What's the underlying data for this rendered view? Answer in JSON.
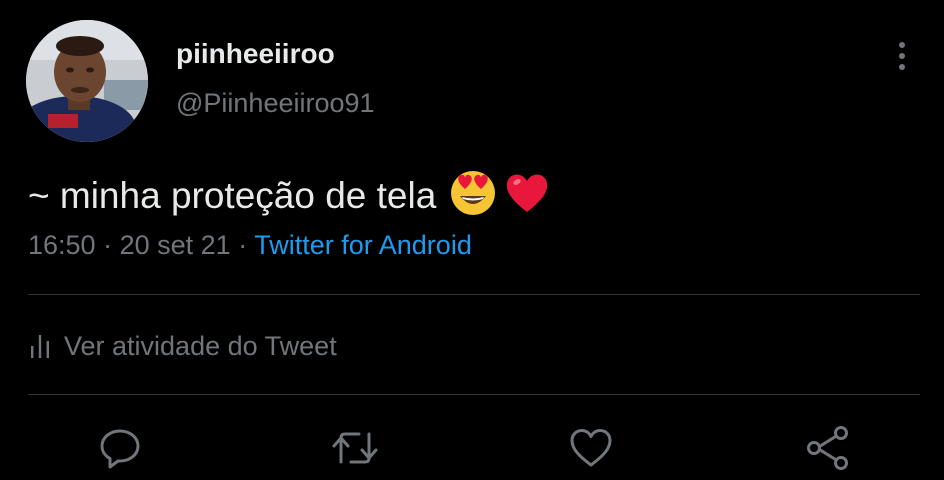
{
  "tweet": {
    "display_name": "piinheeiiroo",
    "handle": "@Piinheeiiroo91",
    "text": "~ minha proteção de tela",
    "emojis": [
      "smiling-face-with-heart-eyes",
      "red-heart"
    ],
    "time": "16:50",
    "separator": "·",
    "date": "20 set 21",
    "source": "Twitter for Android"
  },
  "activity": {
    "label": "Ver atividade do Tweet",
    "icon": "bar-chart-icon"
  },
  "actions": [
    {
      "name": "reply",
      "icon": "reply-icon"
    },
    {
      "name": "retweet",
      "icon": "retweet-icon"
    },
    {
      "name": "like",
      "icon": "heart-icon"
    },
    {
      "name": "share",
      "icon": "share-icon"
    }
  ],
  "colors": {
    "background": "#000000",
    "text_primary": "#e7e9ea",
    "text_secondary": "#71767b",
    "link": "#1d9bf0",
    "divider": "#2f3336",
    "heart_emoji": "#e8173b",
    "face_emoji": "#f5c533"
  }
}
